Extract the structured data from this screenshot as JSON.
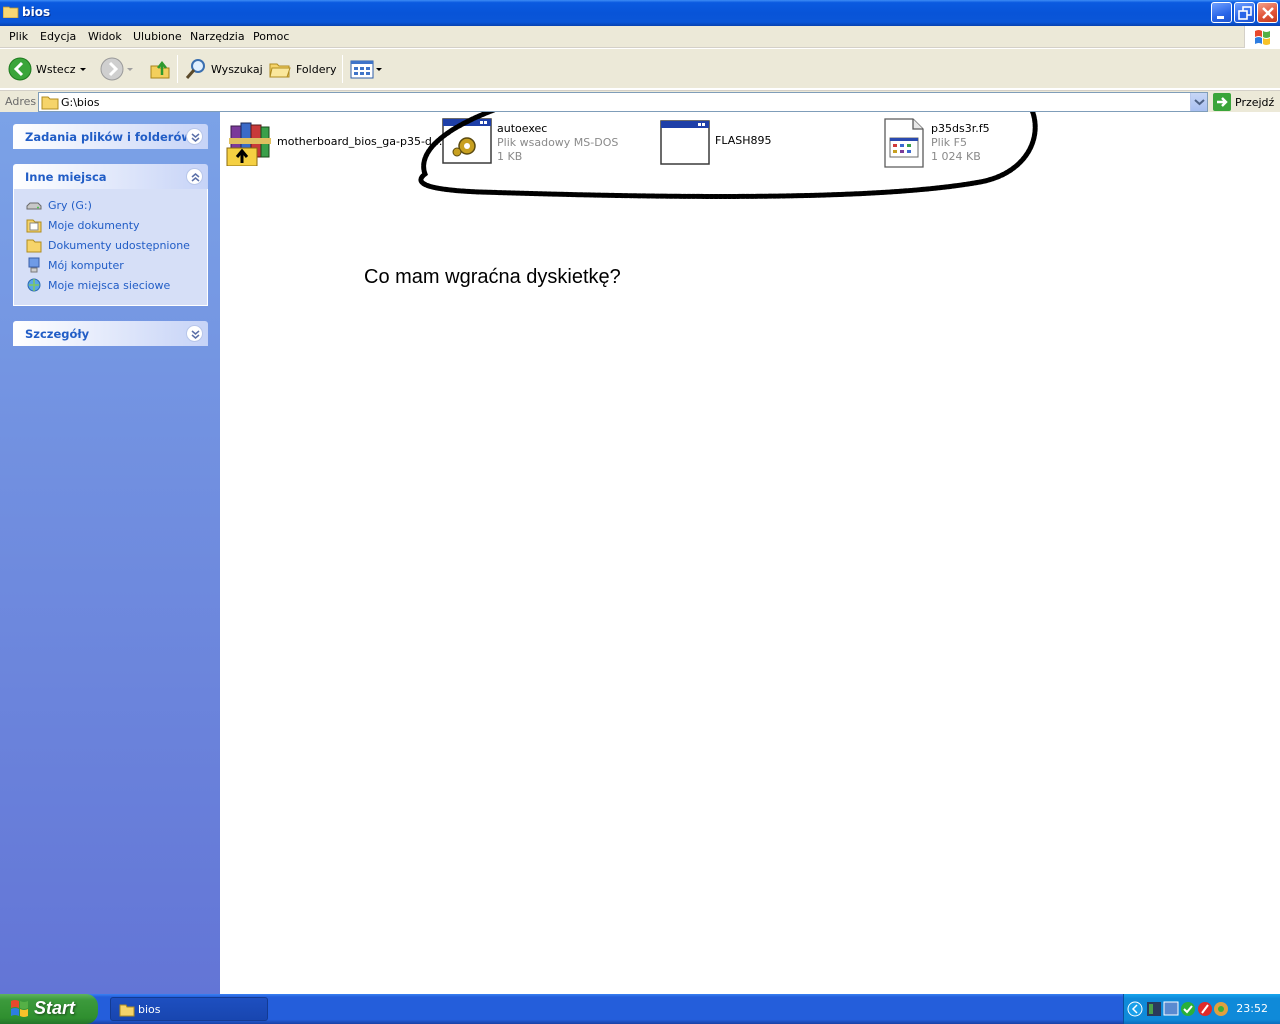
{
  "window": {
    "title": "bios"
  },
  "menu": {
    "items": [
      "Plik",
      "Edycja",
      "Widok",
      "Ulubione",
      "Narzędzia",
      "Pomoc"
    ]
  },
  "toolbar": {
    "back_label": "Wstecz",
    "search_label": "Wyszukaj",
    "folders_label": "Foldery"
  },
  "address": {
    "label": "Adres",
    "value": "G:\\bios",
    "go_label": "Przejdź"
  },
  "sidebar": {
    "tasks_title": "Zadania plików i folderów",
    "places_title": "Inne miejsca",
    "places": [
      "Gry (G:)",
      "Moje dokumenty",
      "Dokumenty udostępnione",
      "Mój komputer",
      "Moje miejsca sieciowe"
    ],
    "details_title": "Szczegóły"
  },
  "files": [
    {
      "name": "motherboard_bios_ga-p35-d...",
      "icon": "winrar-archive-icon"
    },
    {
      "name": "autoexec",
      "type": "Plik wsadowy MS-DOS",
      "size": "1 KB",
      "icon": "batch-file-icon"
    },
    {
      "name": "FLASH895",
      "icon": "dos-app-icon"
    },
    {
      "name": "p35ds3r.f5",
      "type": "Plik F5",
      "size": "1 024 KB",
      "icon": "generic-file-icon"
    }
  ],
  "note": "Co mam wgraćna dyskietkę?",
  "taskbar": {
    "start_label": "Start",
    "task_label": "bios",
    "clock": "23:52"
  },
  "colors": {
    "titlebar": "#0a56d8",
    "sidebar_top": "#7ba2e7",
    "sidebar_bottom": "#6375d6",
    "link": "#215dc6",
    "taskbar": "#245edb",
    "start": "#3c9a3c"
  }
}
